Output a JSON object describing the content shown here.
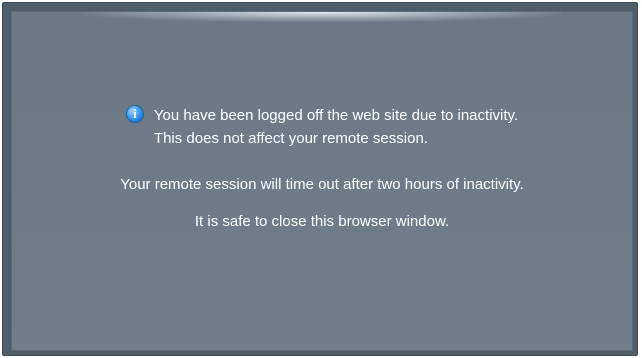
{
  "message": {
    "icon": "info-icon",
    "icon_glyph": "i",
    "logged_off_line1": "You have been logged off the web site due to inactivity.",
    "logged_off_line2": "This does not affect your remote session.",
    "timeout_notice": "Your remote session will time out after two hours of inactivity.",
    "close_notice": "It is safe to close this browser window."
  },
  "colors": {
    "panel_background": "#6f7b88",
    "frame_border": "#4f5d68",
    "text": "#ffffff",
    "icon_blue": "#2f8fe6"
  }
}
